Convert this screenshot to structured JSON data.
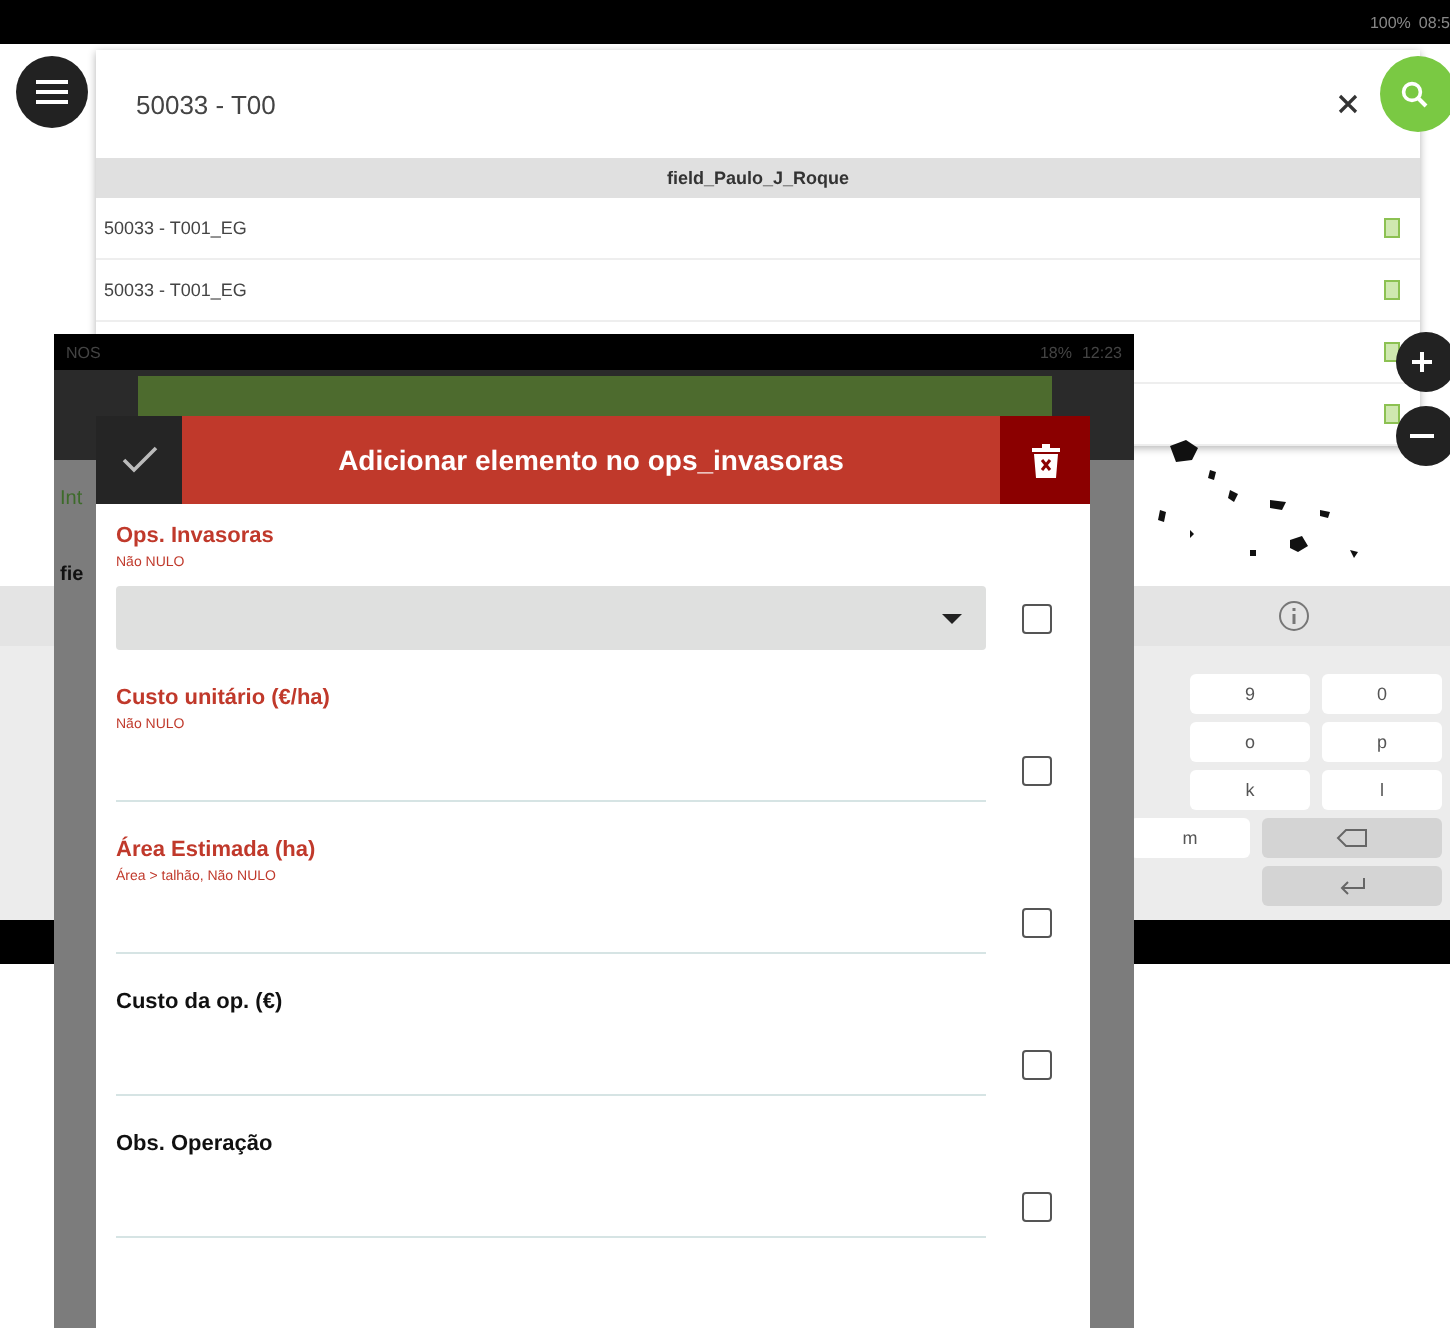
{
  "status_bar": {
    "battery": "100%",
    "time": "08:5"
  },
  "search": {
    "value": "50033 - T00"
  },
  "results": {
    "group": "field_Paulo_J_Roque",
    "rows": [
      {
        "label": "50033 - T001_EG"
      },
      {
        "label": "50033 - T001_EG"
      },
      {},
      {}
    ]
  },
  "keyboard": {
    "rows": [
      {
        "keys": [
          {
            "kind": "char",
            "label": "9"
          },
          {
            "kind": "char",
            "label": "0"
          }
        ]
      },
      {
        "keys": [
          {
            "kind": "char",
            "label": "o"
          },
          {
            "kind": "char",
            "label": "p"
          }
        ]
      },
      {
        "keys": [
          {
            "kind": "char",
            "label": "k"
          },
          {
            "kind": "char",
            "label": "l"
          }
        ]
      },
      {
        "keys": [
          {
            "kind": "char",
            "label": "m"
          },
          {
            "kind": "backspace"
          }
        ]
      },
      {
        "keys": [
          {
            "kind": "enter"
          }
        ]
      }
    ]
  },
  "second_screen": {
    "status_bar": {
      "carrier": "NOS",
      "battery": "18%",
      "time": "12:23"
    },
    "cut_texts": [
      "Int",
      "fie"
    ]
  },
  "dialog": {
    "title": "Adicionar elemento no ops_invasoras",
    "fields": [
      {
        "label": "Ops. Invasoras",
        "hint": "Não NULO",
        "kind": "dropdown",
        "required": true,
        "checked": false
      },
      {
        "label": "Custo unitário (€/ha)",
        "hint": "Não NULO",
        "kind": "text",
        "required": true,
        "checked": false
      },
      {
        "label": "Área Estimada (ha)",
        "hint": "Área > talhão, Não NULO",
        "kind": "text",
        "required": true,
        "checked": false
      },
      {
        "label": "Custo da op. (€)",
        "kind": "text",
        "required": false,
        "checked": false
      },
      {
        "label": "Obs. Operação",
        "kind": "text",
        "required": false,
        "checked": false
      }
    ]
  }
}
